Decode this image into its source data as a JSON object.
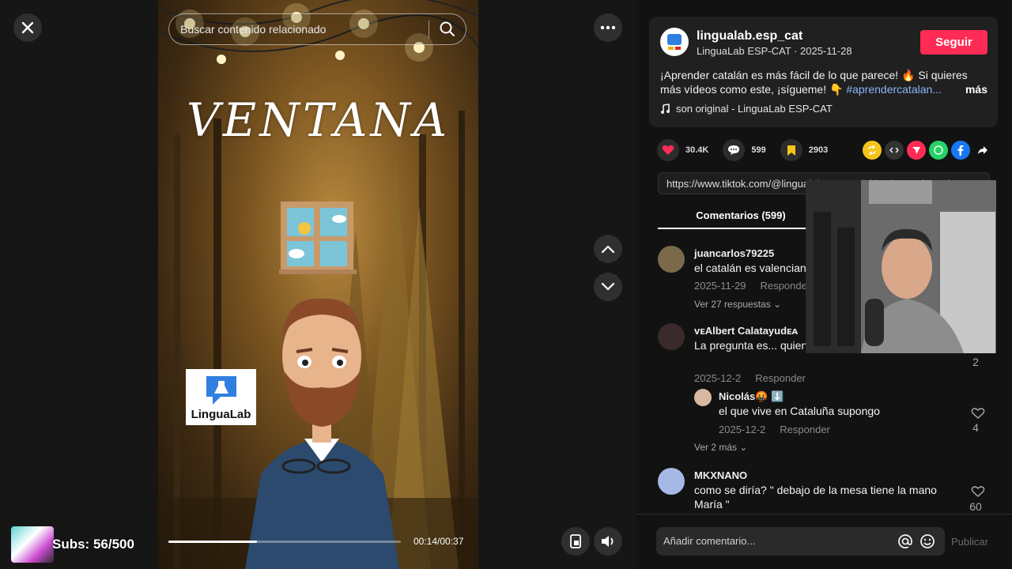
{
  "player": {
    "search_placeholder": "Buscar contenido relacionado",
    "video_title": "VENTANA",
    "logo_text": "LinguaLab",
    "time": "00:14/00:37",
    "progress": 0.38,
    "subs_text": "Subs: 56/500"
  },
  "post": {
    "username": "lingualab.esp_cat",
    "subtitle": "LinguaLab ESP-CAT · 2025-11-28",
    "follow_label": "Seguir",
    "desc_line1": "¡Aprender catalán es más fácil de lo que parece! 🔥  Si quieres",
    "desc_line2": "más vídeos como este, ¡síg",
    "desc_line2b": "ueme! 👇 ",
    "desc_tag": "#aprendercatalan...",
    "desc_more": "más",
    "sound": "son original - LinguaLab ESP-CAT",
    "likes": "30.4K",
    "comments_count": "599",
    "saves": "2903",
    "url": "https://www.tiktok.com/@lingualab.esp_cat/video/...   Copiar enlace",
    "tab_comments": "Comentarios (599)"
  },
  "comments": [
    {
      "user": "juancarlos79225",
      "text": "el catalán es valenciano",
      "date": "2025-11-29",
      "reply": "Responder",
      "view_replies": "Ver 27 respuestas"
    },
    {
      "user": "ᴠᴇAlbert Calatayudᴇᴀ",
      "text": "La pregunta es... quien quiere aprender catalán ???",
      "date": "2025-12-2",
      "reply": "Responder",
      "likes": "2"
    },
    {
      "user": "Nicolás🤬 ⬇️",
      "text": "el que vive en Cataluña supongo",
      "date": "2025-12-2",
      "reply": "Responder",
      "likes": "4",
      "view_more": "Ver 2 más"
    },
    {
      "user": "MKXNANO",
      "text": "como se diría? \" debajo de la mesa tiene la mano María \"",
      "likes": "60"
    }
  ],
  "composer": {
    "placeholder": "Añadir comentario...",
    "publish_label": "Publicar"
  },
  "colors": {
    "accent": "#fe2c55",
    "hashtag": "#8ab4f8",
    "background": "#121212"
  }
}
